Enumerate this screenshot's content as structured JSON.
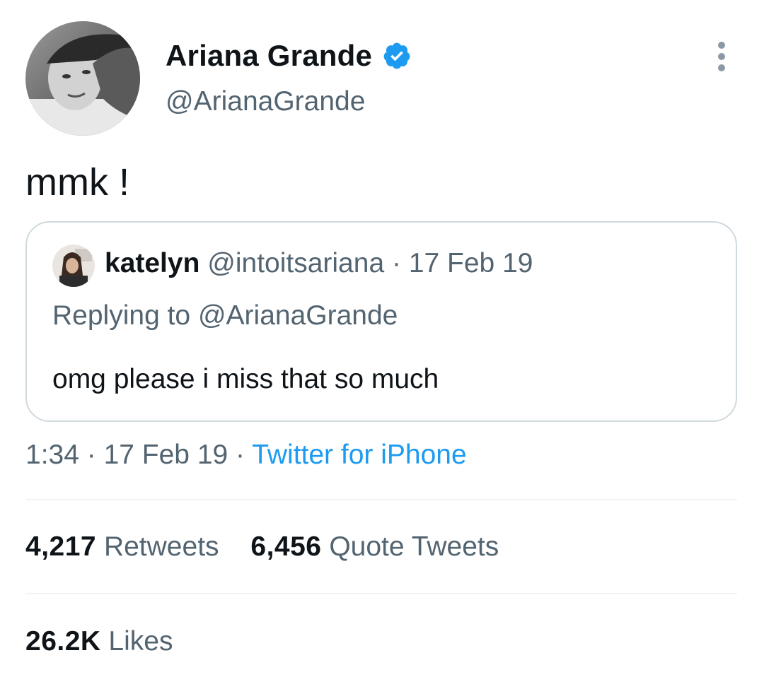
{
  "author": {
    "display_name": "Ariana Grande",
    "handle": "@ArianaGrande",
    "verified_icon": "verified-badge-icon",
    "avatar_icon": "user-avatar"
  },
  "menu_icon": "more-options-icon",
  "tweet": {
    "text": "mmk !"
  },
  "quoted_tweet": {
    "name": "katelyn",
    "handle": "@intoitsariana",
    "separator": " · ",
    "date": "17 Feb 19",
    "replying_prefix": "Replying to ",
    "replying_to": "@ArianaGrande",
    "text": "omg please i miss that so much"
  },
  "meta": {
    "time": "1:34",
    "sep1": " · ",
    "date": "17 Feb 19",
    "sep2": " · ",
    "source": "Twitter for iPhone"
  },
  "stats": {
    "retweets_count": "4,217",
    "retweets_label": "Retweets",
    "quotes_count": "6,456",
    "quotes_label": "Quote Tweets",
    "likes_count": "26.2K",
    "likes_label": "Likes"
  },
  "colors": {
    "primary_text": "#0f1419",
    "secondary_text": "#536471",
    "link": "#1d9bf0",
    "border": "#cfd9de",
    "divider": "#eff3f4"
  }
}
